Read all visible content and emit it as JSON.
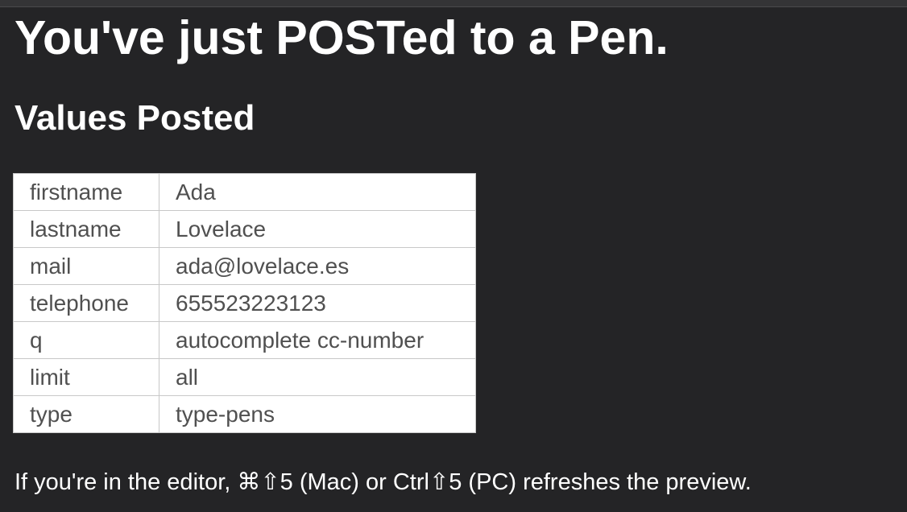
{
  "heading": "You've just POSTed to a Pen.",
  "subheading": "Values Posted",
  "rows": [
    {
      "key": "firstname",
      "value": "Ada"
    },
    {
      "key": "lastname",
      "value": "Lovelace"
    },
    {
      "key": "mail",
      "value": "ada@lovelace.es"
    },
    {
      "key": "telephone",
      "value": "655523223123"
    },
    {
      "key": "q",
      "value": "autocomplete cc-number"
    },
    {
      "key": "limit",
      "value": "all"
    },
    {
      "key": "type",
      "value": "type-pens"
    }
  ],
  "note": "If you're in the editor, ⌘⇧5 (Mac) or Ctrl⇧5 (PC) refreshes the preview.",
  "colors": {
    "background": "#242426",
    "table_background": "#ffffff",
    "table_text": "#505050",
    "table_border": "#c8c8c8"
  }
}
